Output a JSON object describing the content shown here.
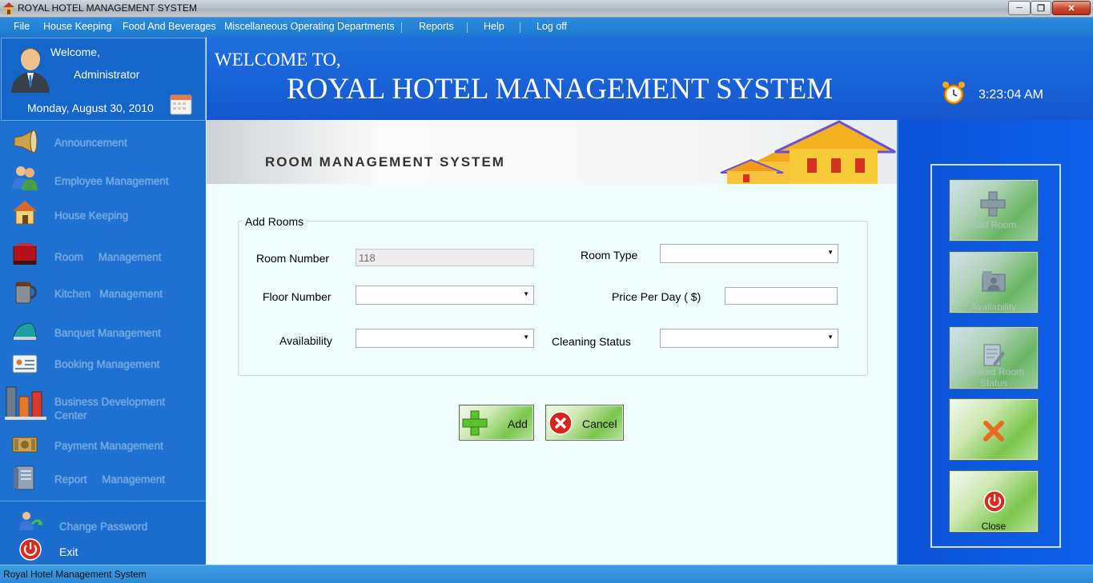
{
  "window": {
    "title": "ROYAL HOTEL MANAGEMENT SYSTEM",
    "controls": {
      "minimize": "minimize-icon",
      "maximize": "maximize-icon",
      "close": "close-icon"
    }
  },
  "menu": {
    "items": [
      "File",
      "House Keeping",
      "Food And Beverages",
      "Miscellaneous Operating Departments",
      "Reports",
      "Help",
      "Log off"
    ]
  },
  "user": {
    "greeting": "Welcome,",
    "name": "Administrator",
    "date": "Monday, August 30, 2010"
  },
  "header": {
    "welcome": "WELCOME TO,",
    "title": "ROYAL HOTEL MANAGEMENT SYSTEM",
    "time": "3:23:04 AM"
  },
  "nav": {
    "items": [
      {
        "label": "Announcement",
        "icon": "megaphone-icon"
      },
      {
        "label": "Employee Management",
        "icon": "users-icon"
      },
      {
        "label": "House Keeping",
        "icon": "house-icon"
      },
      {
        "label": "Room     Management",
        "icon": "room-icon"
      },
      {
        "label": "Kitchen   Management",
        "icon": "mug-icon"
      },
      {
        "label": "Banquet Management",
        "icon": "iron-icon"
      },
      {
        "label": "Booking Management",
        "icon": "id-card-icon"
      },
      {
        "label": "Business Development\nCenter",
        "icon": "bar-chart-icon"
      },
      {
        "label": "Payment Management",
        "icon": "money-icon"
      },
      {
        "label": "Report     Management",
        "icon": "binder-icon"
      }
    ],
    "change_password": "Change Password",
    "exit": "Exit"
  },
  "banner": {
    "title": "ROOM MANAGEMENT SYSTEM"
  },
  "form": {
    "group_title": "Add Rooms",
    "room_number_label": "Room Number",
    "room_number_value": "118",
    "room_type_label": "Room Type",
    "room_type_value": "",
    "floor_number_label": "Floor Number",
    "floor_number_value": "",
    "price_label": "Price Per Day ( $)",
    "price_value": "",
    "availability_label": "Availability",
    "availability_value": "",
    "cleaning_label": "Cleaning Status",
    "cleaning_value": "",
    "add_button": "Add",
    "cancel_button": "Cancel"
  },
  "side_buttons": {
    "add_room": "Add Room",
    "availability": "Availability",
    "booked_status": "Booked Room Status",
    "delete": "",
    "close": "Close"
  },
  "status_bar": {
    "text": "Royal Hotel Management System"
  },
  "colors": {
    "menu_blue": "#1d78cf",
    "header_blue": "#1456cf",
    "nav_blue": "#1e71d0",
    "content_bg": "#eefcfb",
    "button_green": "#7ac64d"
  }
}
